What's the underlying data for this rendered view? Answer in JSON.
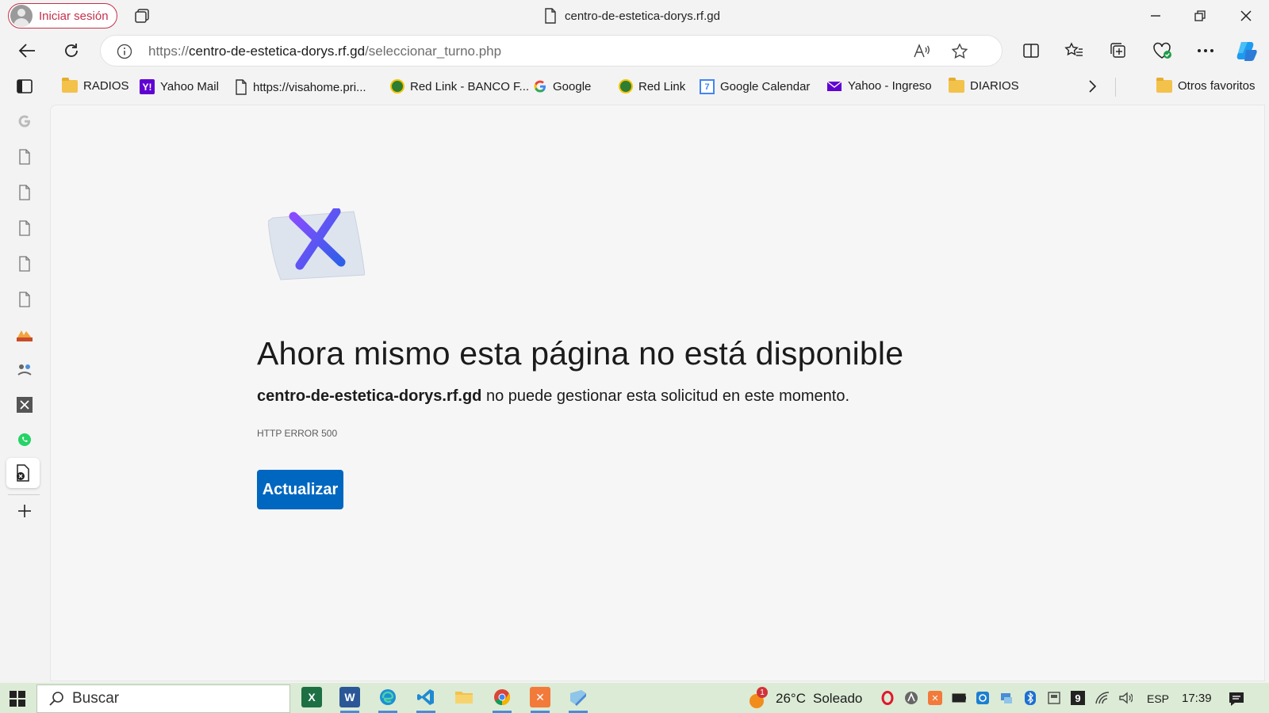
{
  "titlebar": {
    "signin_label": "Iniciar sesión",
    "tab_title": "centro-de-estetica-dorys.rf.gd"
  },
  "addressbar": {
    "url_prefix": "https://",
    "url_domain": "centro-de-estetica-dorys.rf.gd",
    "url_path": "/seleccionar_turno.php"
  },
  "favorites": [
    {
      "label": "RADIOS",
      "icon": "folder-icon"
    },
    {
      "label": "Yahoo Mail",
      "icon": "yahoo-icon"
    },
    {
      "label": "https://visahome.pri...",
      "icon": "page-icon"
    },
    {
      "label": "Red Link - BANCO F...",
      "icon": "redlink-icon"
    },
    {
      "label": "Google",
      "icon": "google-icon"
    },
    {
      "label": "Red Link",
      "icon": "redlink-icon"
    },
    {
      "label": "Google Calendar",
      "icon": "calendar-icon"
    },
    {
      "label": "Yahoo - Ingreso",
      "icon": "mail-icon"
    },
    {
      "label": "DIARIOS",
      "icon": "folder-icon"
    }
  ],
  "other_favorites": "Otros favoritos",
  "error": {
    "title": "Ahora mismo esta página no está disponible",
    "host": "centro-de-estetica-dorys.rf.gd",
    "message": " no puede gestionar esta solicitud en este momento.",
    "code": "HTTP ERROR 500",
    "refresh_label": "Actualizar"
  },
  "taskbar": {
    "search_label": "Buscar",
    "weather_badge": "1",
    "weather_temp": "26°C",
    "weather_desc": "Soleado",
    "tray_9": "9",
    "language": "ESP",
    "time": "17:39"
  },
  "colors": {
    "accent": "#0067c0",
    "signin_border": "#c4314b",
    "taskbar": "#dcebd5"
  }
}
